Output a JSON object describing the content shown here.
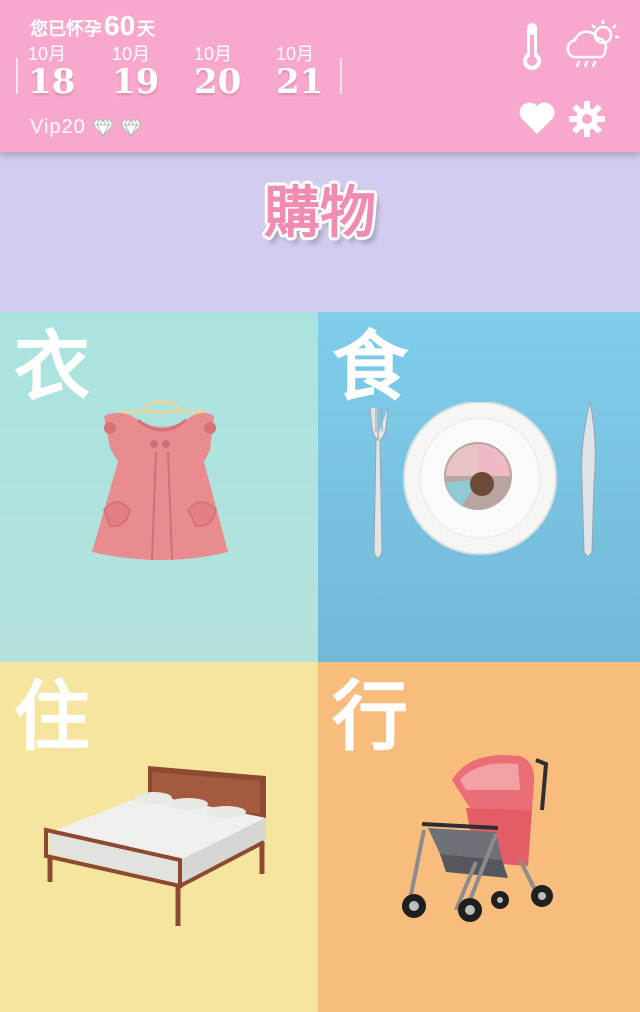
{
  "header": {
    "pregnant_prefix": "您已怀孕",
    "pregnant_days": "60",
    "pregnant_suffix": "天",
    "dates": [
      {
        "month": "10月",
        "day": "18"
      },
      {
        "month": "10月",
        "day": "19"
      },
      {
        "month": "10月",
        "day": "20"
      },
      {
        "month": "10月",
        "day": "21"
      }
    ],
    "vip_label": "Vip20",
    "icons": [
      "thermometer-icon",
      "weather-cloud-sun-rain-icon",
      "heart-icon",
      "gear-icon"
    ]
  },
  "shopping": {
    "title": "購物"
  },
  "categories": [
    {
      "label": "衣",
      "item": "baby-dress"
    },
    {
      "label": "食",
      "item": "plate-fork-knife"
    },
    {
      "label": "住",
      "item": "bed"
    },
    {
      "label": "行",
      "item": "stroller"
    }
  ],
  "colors": {
    "header": "#f7a8cc",
    "band": "#d2ccee",
    "cloth": "#b6e2dc",
    "food": "#72b9d8",
    "house": "#f5e59e",
    "go": "#f8bd7c",
    "title": "#f08bb2"
  }
}
